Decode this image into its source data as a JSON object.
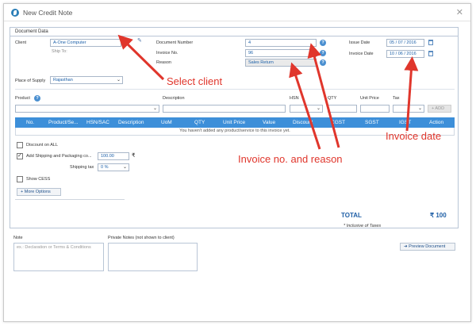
{
  "window": {
    "title": "New Credit Note",
    "close_glyph": "✕"
  },
  "section": {
    "title": "Document Data"
  },
  "client": {
    "label": "Client",
    "value": "A-One Computer",
    "ship_to_label": "Ship To:"
  },
  "document_number": {
    "label": "Document Number",
    "value": "4"
  },
  "invoice_no": {
    "label": "Invoice No.",
    "value": "96"
  },
  "reason": {
    "label": "Reason",
    "value": "Sales Return"
  },
  "issue_date": {
    "label": "Issue Date",
    "value": "05 / 07 / 2016"
  },
  "invoice_date": {
    "label": "Invoice Date",
    "value": "10 / 06 / 2016"
  },
  "place_of_supply": {
    "label": "Place of Supply",
    "value": "Rajasthan"
  },
  "product_row": {
    "product_label": "Product",
    "description_label": "Description",
    "hsn_label": "HSN",
    "qty_label": "QTY",
    "unit_price_label": "Unit Price",
    "tax_label": "Tax",
    "add_label": "+ ADD"
  },
  "grid": {
    "columns": [
      "No.",
      "Product/Se...",
      "HSN/SAC",
      "Description",
      "UoM",
      "QTY",
      "Unit Price",
      "Value",
      "Discount",
      "CGST",
      "SGST",
      "IGST",
      "Action"
    ],
    "empty_message": "You haven't added any product/service to this invoice yet."
  },
  "options": {
    "discount_label": "Discount on ALL",
    "shipping_label": "Add Shipping and Packaging co...",
    "shipping_value": "100.00",
    "shipping_tax_label": "Shipping tax",
    "shipping_tax_value": "0 %",
    "cess_label": "Show CESS",
    "more_options_label": "More Options"
  },
  "totals": {
    "label": "TOTAL",
    "value": "₹ 100",
    "inclusive_note": "* Inclusive of Taxes"
  },
  "notes": {
    "note_label": "Note",
    "note_placeholder": "ex.: Declaration or Terms & Conditions",
    "private_label": "Private Notes (not shown to client)"
  },
  "preview_button": {
    "label": "Preview Document"
  },
  "annotations": {
    "select_client": "Select client",
    "invoice_no_reason": "Invoice no. and reason",
    "invoice_date": "Invoice date"
  },
  "colors": {
    "accent": "#3d8fd9",
    "annotation": "#e0362c",
    "total": "#1f5fa6"
  },
  "icons": [
    "app-logo-icon",
    "close-icon",
    "edit-pencil-icon",
    "help-icon",
    "calendar-icon",
    "chevron-down-icon",
    "plus-icon",
    "arrow-right-icon"
  ]
}
